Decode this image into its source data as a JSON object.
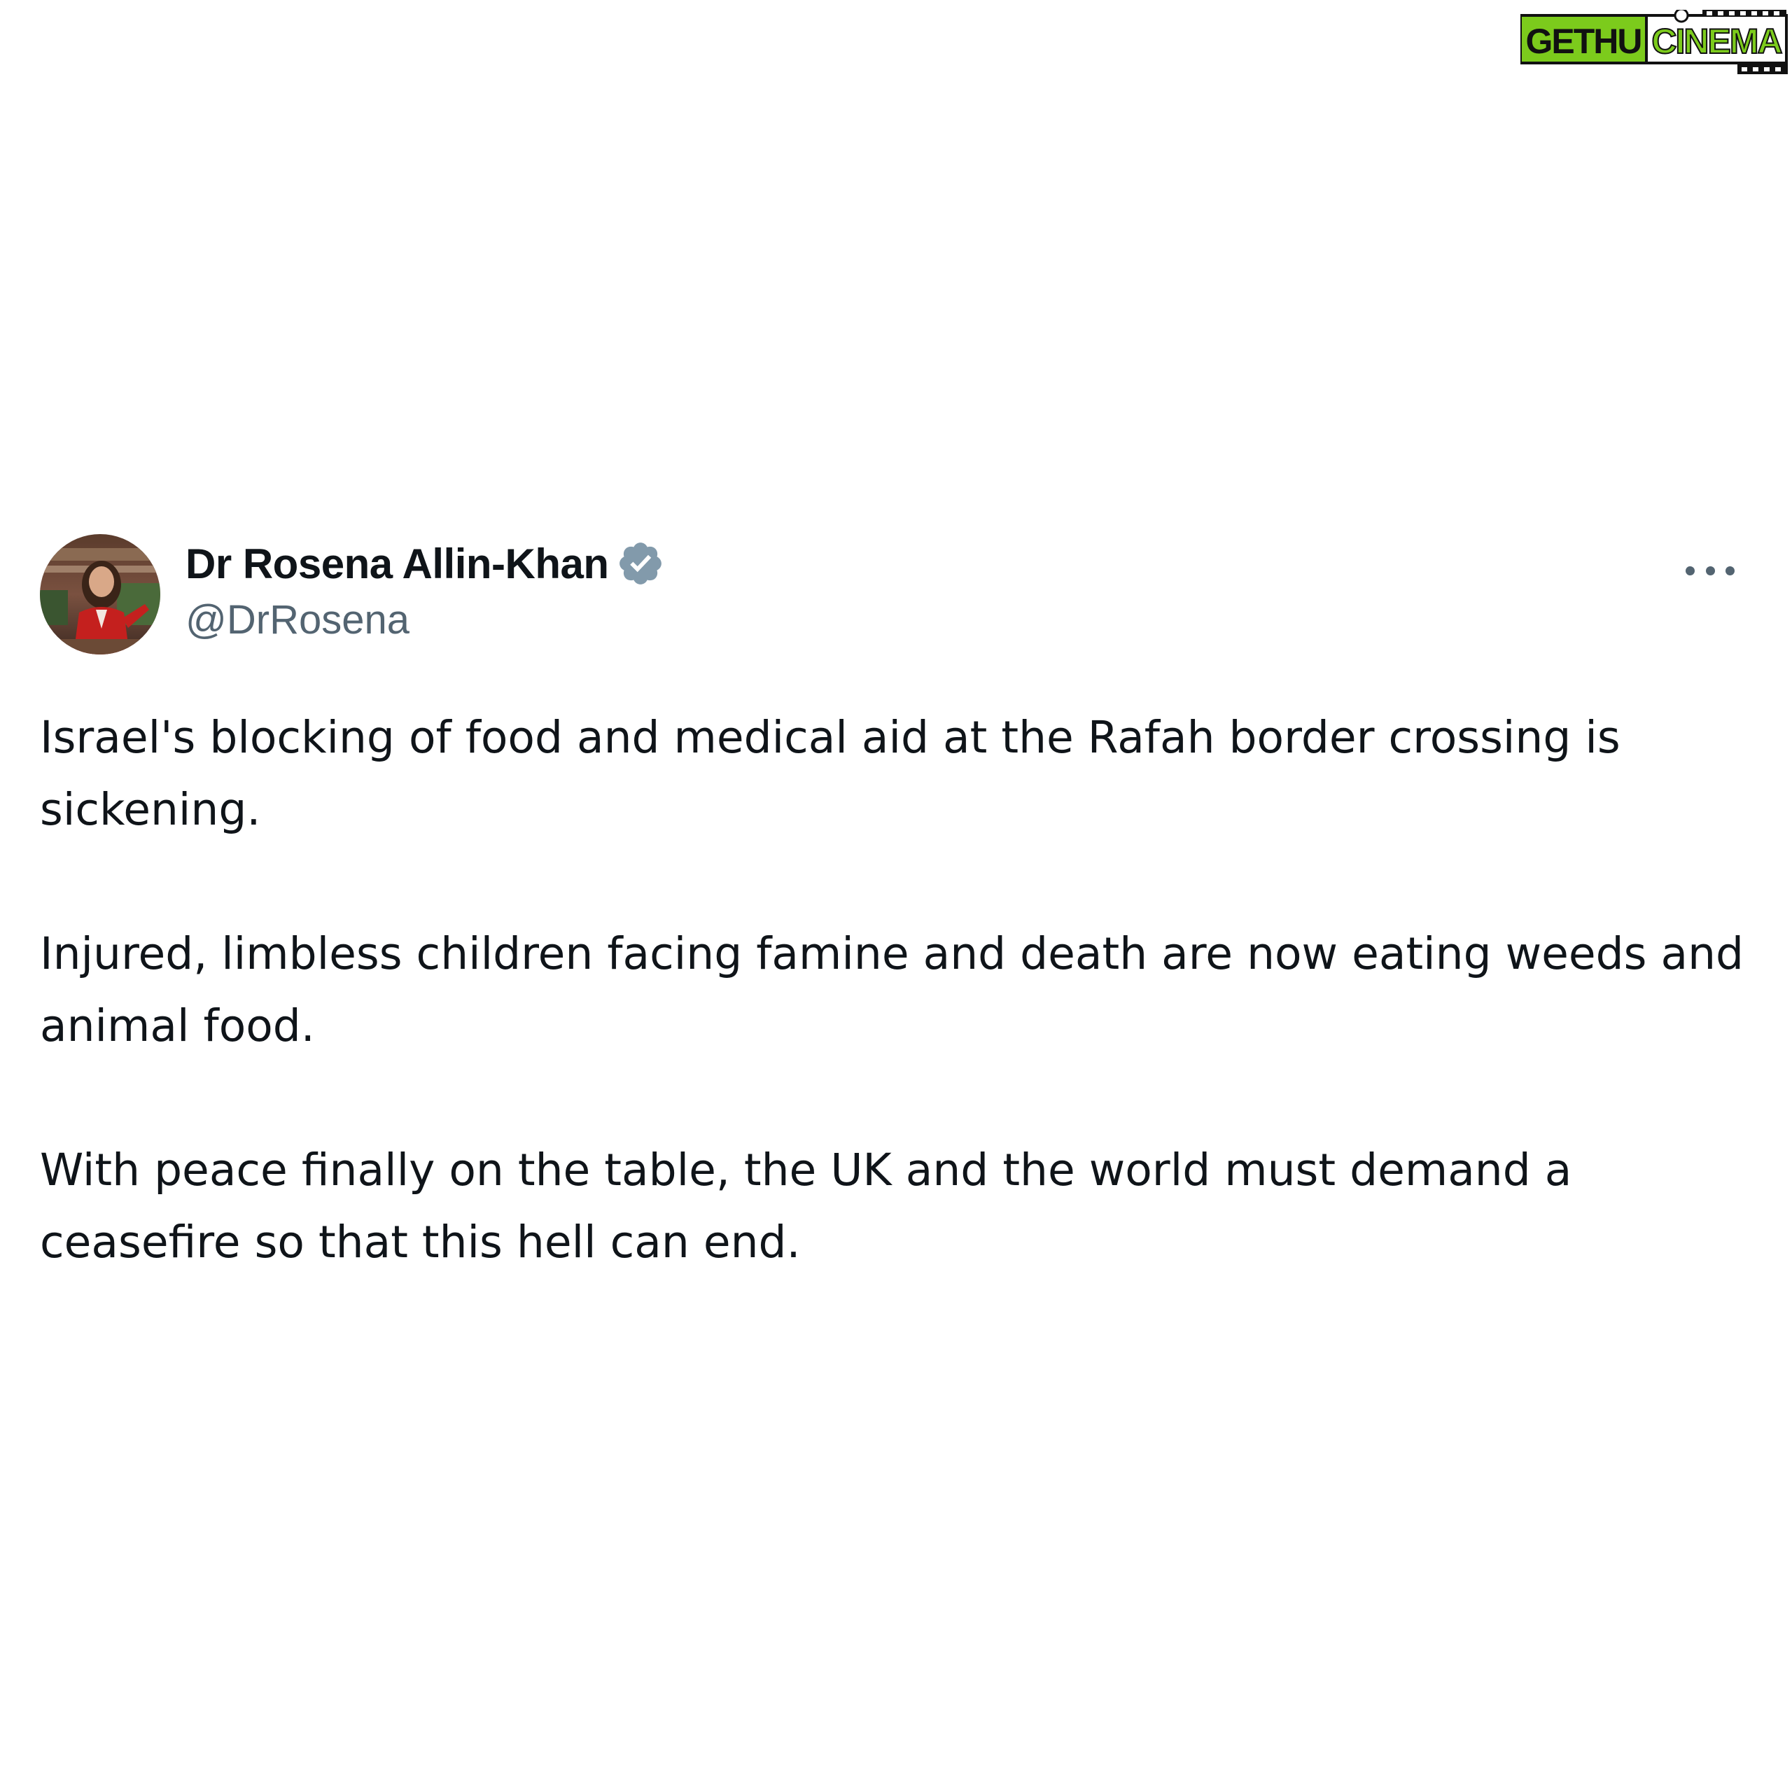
{
  "watermark": {
    "text_left": "GETHU",
    "text_right": "CINEMA",
    "colors": {
      "green": "#7ccb1c",
      "black": "#111111",
      "white": "#ffffff"
    },
    "icon": "film-camera-icon"
  },
  "tweet": {
    "author": {
      "display_name": "Dr Rosena Allin-Khan",
      "handle": "@DrRosena",
      "verified": true,
      "verified_icon": "verified-badge-icon",
      "avatar_icon": "profile-photo-avatar"
    },
    "more_icon": "more-options-icon",
    "paragraphs": [
      "Israel's blocking of food and medical aid at the Rafah border crossing is sickening.",
      "Injured, limbless children facing famine and death are now eating weeds and animal food.",
      "With peace finally on the table, the UK and the world must demand a ceasefire so that this hell can end."
    ]
  },
  "colors": {
    "background": "#ffffff",
    "text_primary": "#0f1419",
    "text_secondary": "#536471",
    "verified_badge": "#829aab"
  }
}
